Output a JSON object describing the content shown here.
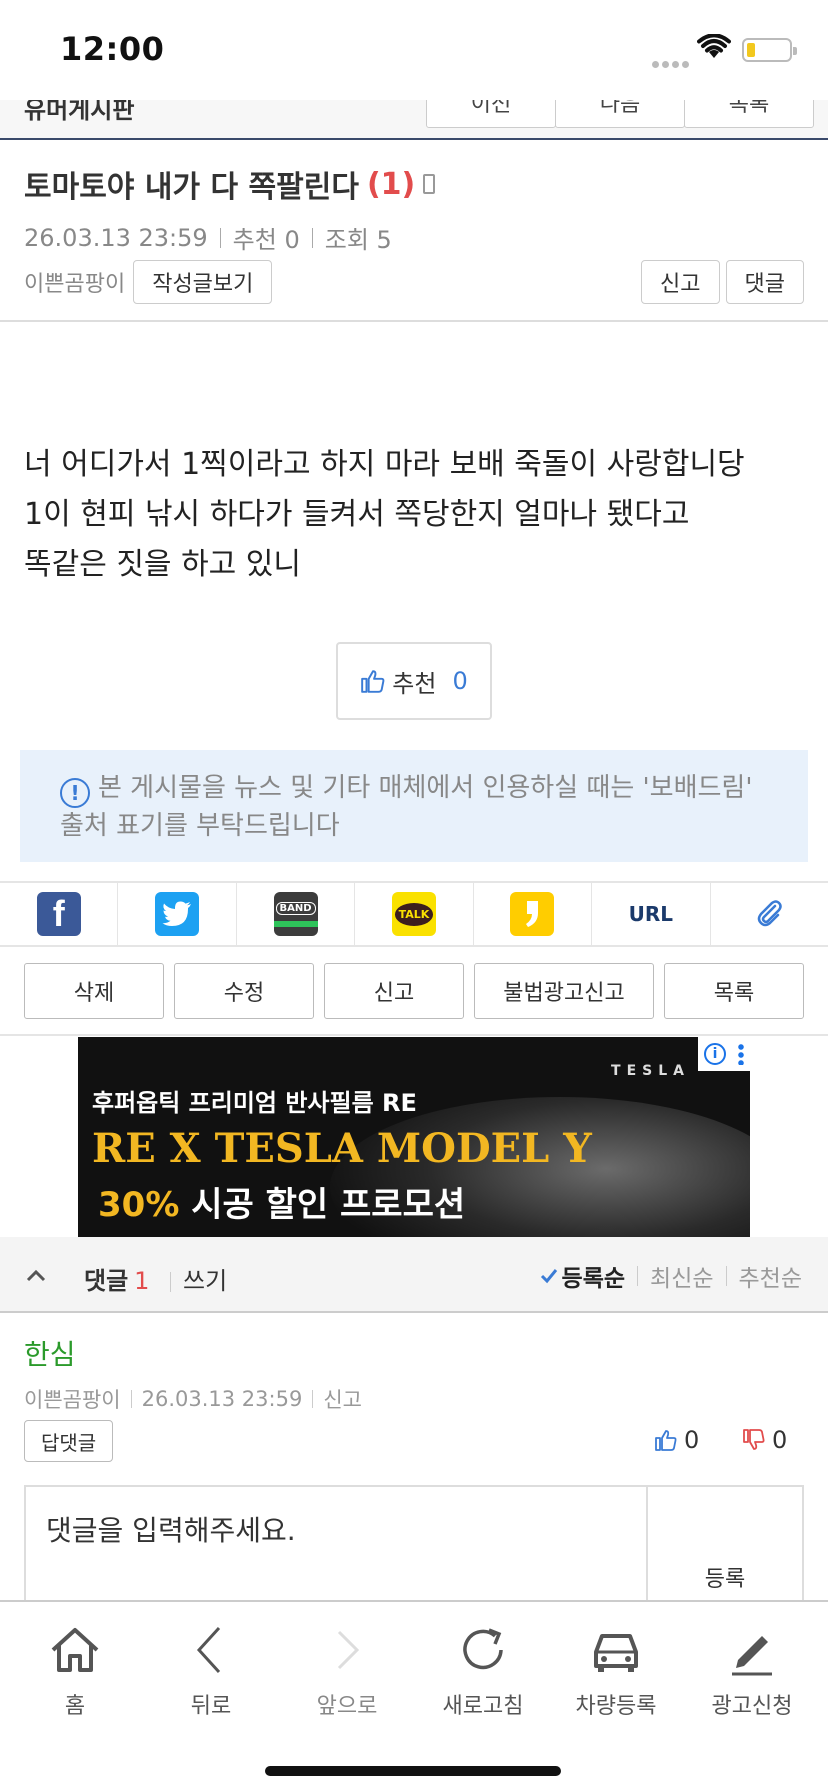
{
  "status_bar": {
    "time": "12:00"
  },
  "board_nav": {
    "board_name": "유머게시판",
    "buttons": [
      "이전",
      "다음",
      "목록"
    ]
  },
  "post": {
    "title": "토마토야 내가 다 쪽팔린다",
    "comment_count": "(1)",
    "date": "26.03.13  23:59",
    "recommend": "추천 0",
    "views": "조회 5",
    "author": "이쁜곰팡이",
    "view_posts_button": "작성글보기",
    "report_button": "신고",
    "comment_button": "댓글",
    "body_lines": [
      "너 어디가서 1찍이라고 하지 마라 보배 죽돌이 사랑합니당",
      "1이 현피 낚시 하다가 들켜서 쪽당한지 얼마나 됐다고",
      "똑같은 짓을 하고 있니"
    ],
    "recommend_button_label": "추천",
    "recommend_count": "0",
    "notice": "본 게시물을 뉴스 및 기타 매체에서 인용하실 때는 '보배드림' 출처 표기를 부탁드립니다"
  },
  "share": {
    "items": [
      "facebook-icon",
      "twitter-icon",
      "band-icon",
      "kakaotalk-icon",
      "kakaostory-icon",
      "URL",
      "paperclip-icon"
    ],
    "band_text": "BAND",
    "talk_text": "TALK",
    "url_label": "URL"
  },
  "actions": [
    "삭제",
    "수정",
    "신고",
    "불법광고신고",
    "목록"
  ],
  "ad": {
    "brand": "TESLA",
    "line1": "후퍼옵틱 프리미엄 반사필름 RE",
    "line2": "RE X TESLA MODEL Y",
    "line3_pct": "30%",
    "line3_rest": " 시공 할인 프로모션",
    "info": "i"
  },
  "comments_header": {
    "label": "댓글",
    "count": "1",
    "write": "쓰기",
    "sort": [
      "등록순",
      "최신순",
      "추천순"
    ]
  },
  "comment": {
    "author": "한심",
    "user": "이쁜곰팡이",
    "date": "26.03.13  23:59",
    "report": "신고",
    "reply_button": "답댓글",
    "likes": "0",
    "dislikes": "0"
  },
  "comment_input": {
    "placeholder": "댓글을 입력해주세요.",
    "submit": "등록"
  },
  "bottom_nav": [
    "홈",
    "뒤로",
    "앞으로",
    "새로고침",
    "차량등록",
    "광고신청"
  ],
  "colors": {
    "accent_blue": "#3a7bd5",
    "red": "#e24c4c",
    "green": "#2b9a2b",
    "ad_gold": "#f2b722"
  }
}
